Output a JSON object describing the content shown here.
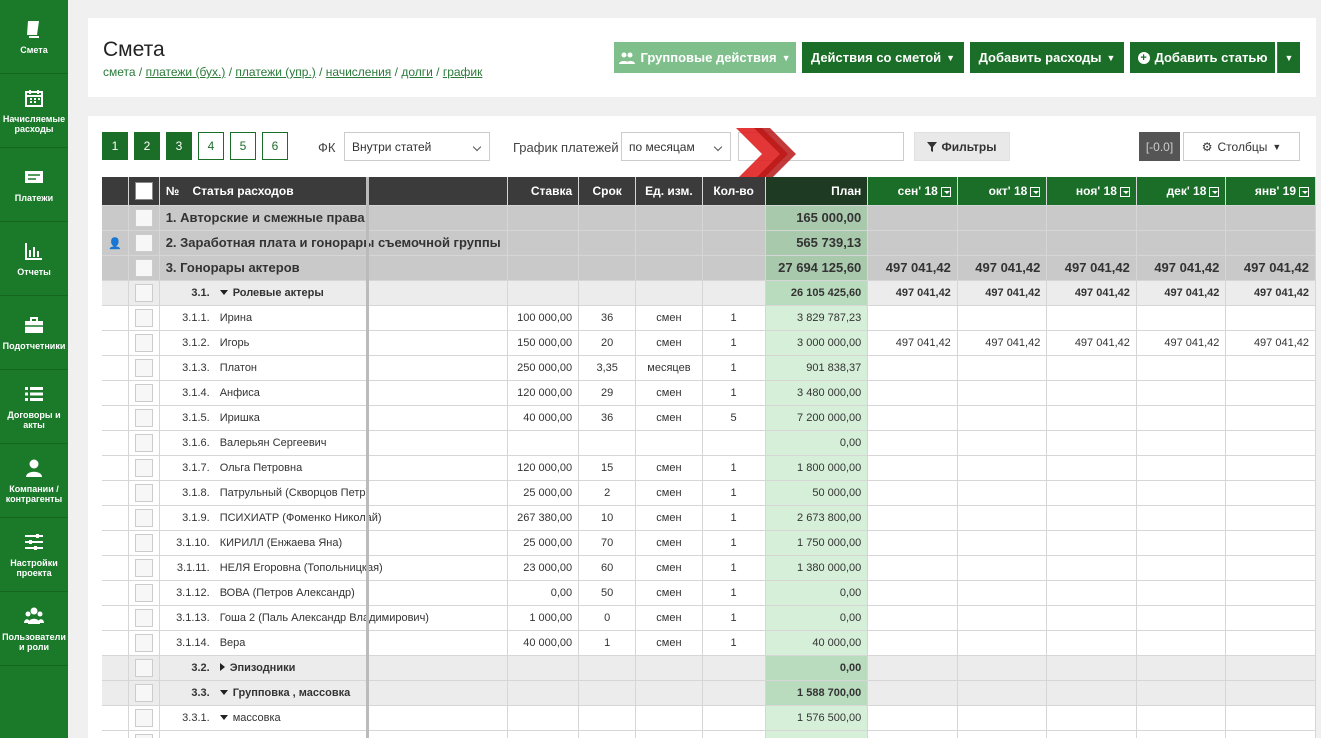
{
  "sidebar": {
    "items": [
      {
        "label": "Смета",
        "icon": "book-icon"
      },
      {
        "label": "Начисляемые расходы",
        "icon": "calendar-icon"
      },
      {
        "label": "Платежи",
        "icon": "payments-icon"
      },
      {
        "label": "Отчеты",
        "icon": "bar-chart-icon"
      },
      {
        "label": "Подотчетники",
        "icon": "briefcase-icon"
      },
      {
        "label": "Договоры и акты",
        "icon": "list-icon"
      },
      {
        "label": "Компании / контрагенты",
        "icon": "user-icon"
      },
      {
        "label": "Настройки проекта",
        "icon": "sliders-icon"
      },
      {
        "label": "Пользователи и роли",
        "icon": "users-icon"
      }
    ]
  },
  "header": {
    "title": "Смета",
    "breadcrumb": {
      "current": "смета",
      "links": [
        "платежи (бух.)",
        "платежи (упр.)",
        "начисления",
        "долги",
        "график"
      ]
    },
    "buttons": {
      "group": "Групповые действия",
      "estimate": "Действия со сметой",
      "add_expenses": "Добавить расходы",
      "add_article": "Добавить статью"
    }
  },
  "toolbar": {
    "pages": [
      "1",
      "2",
      "3",
      "4",
      "5",
      "6"
    ],
    "active_pages": [
      "1",
      "2",
      "3"
    ],
    "fk_label": "ФК",
    "fk_value": "Внутри статей",
    "schedule_label": "График платежей",
    "schedule_value": "по месяцам",
    "filters": "Фильтры",
    "version": "[-0.0]",
    "columns": "Столбцы"
  },
  "table": {
    "headers": {
      "num": "№",
      "article": "Статья расходов",
      "rate": "Ставка",
      "term": "Срок",
      "unit": "Ед. изм.",
      "qty": "Кол-во",
      "plan": "План"
    },
    "months": [
      "сен' 18",
      "окт' 18",
      "ноя' 18",
      "дек' 18",
      "янв' 19"
    ],
    "rows": [
      {
        "type": "grp",
        "num": "",
        "name": "1. Авторские и смежные права",
        "rate": "",
        "term": "",
        "unit": "",
        "qty": "",
        "plan": "165 000,00",
        "m": [
          "",
          "",
          "",
          "",
          ""
        ]
      },
      {
        "type": "grp",
        "num": "",
        "name": "2. Заработная плата и гонорары съемочной группы",
        "rate": "",
        "term": "",
        "unit": "",
        "qty": "",
        "plan": "565 739,13",
        "m": [
          "",
          "",
          "",
          "",
          ""
        ],
        "person": true
      },
      {
        "type": "grp",
        "num": "",
        "name": "3. Гонорары актеров",
        "rate": "",
        "term": "",
        "unit": "",
        "qty": "",
        "plan": "27 694 125,60",
        "m": [
          "497 041,42",
          "497 041,42",
          "497 041,42",
          "497 041,42",
          "497 041,42"
        ]
      },
      {
        "type": "sub",
        "num": "3.1.",
        "name": "Ролевые актеры",
        "exp": "d",
        "rate": "",
        "term": "",
        "unit": "",
        "qty": "",
        "plan": "26 105 425,60",
        "m": [
          "497 041,42",
          "497 041,42",
          "497 041,42",
          "497 041,42",
          "497 041,42"
        ]
      },
      {
        "type": "item",
        "num": "3.1.1.",
        "name": "Ирина",
        "rate": "100 000,00",
        "term": "36",
        "unit": "смен",
        "qty": "1",
        "plan": "3 829 787,23",
        "m": [
          "",
          "",
          "",
          "",
          ""
        ]
      },
      {
        "type": "item",
        "num": "3.1.2.",
        "name": "Игорь",
        "rate": "150 000,00",
        "term": "20",
        "unit": "смен",
        "qty": "1",
        "plan": "3 000 000,00",
        "m": [
          "497 041,42",
          "497 041,42",
          "497 041,42",
          "497 041,42",
          "497 041,42"
        ]
      },
      {
        "type": "item",
        "num": "3.1.3.",
        "name": "Платон",
        "rate": "250 000,00",
        "term": "3,35",
        "unit": "месяцев",
        "qty": "1",
        "plan": "901 838,37",
        "m": [
          "",
          "",
          "",
          "",
          ""
        ]
      },
      {
        "type": "item",
        "num": "3.1.4.",
        "name": "Анфиса",
        "rate": "120 000,00",
        "term": "29",
        "unit": "смен",
        "qty": "1",
        "plan": "3 480 000,00",
        "m": [
          "",
          "",
          "",
          "",
          ""
        ]
      },
      {
        "type": "item",
        "num": "3.1.5.",
        "name": "Иришка",
        "rate": "40 000,00",
        "term": "36",
        "unit": "смен",
        "qty": "5",
        "plan": "7 200 000,00",
        "m": [
          "",
          "",
          "",
          "",
          ""
        ]
      },
      {
        "type": "item",
        "num": "3.1.6.",
        "name": "Валерьян Сергеевич",
        "rate": "",
        "term": "",
        "unit": "",
        "qty": "",
        "plan": "0,00",
        "m": [
          "",
          "",
          "",
          "",
          ""
        ]
      },
      {
        "type": "item",
        "num": "3.1.7.",
        "name": "Ольга Петровна",
        "rate": "120 000,00",
        "term": "15",
        "unit": "смен",
        "qty": "1",
        "plan": "1 800 000,00",
        "m": [
          "",
          "",
          "",
          "",
          ""
        ]
      },
      {
        "type": "item",
        "num": "3.1.8.",
        "name": "Патрульный (Скворцов Петр)",
        "rate": "25 000,00",
        "term": "2",
        "unit": "смен",
        "qty": "1",
        "plan": "50 000,00",
        "m": [
          "",
          "",
          "",
          "",
          ""
        ]
      },
      {
        "type": "item",
        "num": "3.1.9.",
        "name": "ПСИХИАТР (Фоменко Николай)",
        "rate": "267 380,00",
        "term": "10",
        "unit": "смен",
        "qty": "1",
        "plan": "2 673 800,00",
        "m": [
          "",
          "",
          "",
          "",
          ""
        ]
      },
      {
        "type": "item",
        "num": "3.1.10.",
        "name": "КИРИЛЛ (Енжаева Яна)",
        "rate": "25 000,00",
        "term": "70",
        "unit": "смен",
        "qty": "1",
        "plan": "1 750 000,00",
        "m": [
          "",
          "",
          "",
          "",
          ""
        ]
      },
      {
        "type": "item",
        "num": "3.1.11.",
        "name": "НЕЛЯ Егоровна (Топольницкая)",
        "rate": "23 000,00",
        "term": "60",
        "unit": "смен",
        "qty": "1",
        "plan": "1 380 000,00",
        "m": [
          "",
          "",
          "",
          "",
          ""
        ]
      },
      {
        "type": "item",
        "num": "3.1.12.",
        "name": "ВОВА (Петров Александр)",
        "rate": "0,00",
        "term": "50",
        "unit": "смен",
        "qty": "1",
        "plan": "0,00",
        "m": [
          "",
          "",
          "",
          "",
          ""
        ]
      },
      {
        "type": "item",
        "num": "3.1.13.",
        "name": "Гоша 2 (Паль Александр Владимирович)",
        "rate": "1 000,00",
        "term": "0",
        "unit": "смен",
        "qty": "1",
        "plan": "0,00",
        "m": [
          "",
          "",
          "",
          "",
          ""
        ]
      },
      {
        "type": "item",
        "num": "3.1.14.",
        "name": "Вера",
        "rate": "40 000,00",
        "term": "1",
        "unit": "смен",
        "qty": "1",
        "plan": "40 000,00",
        "m": [
          "",
          "",
          "",
          "",
          ""
        ]
      },
      {
        "type": "sub",
        "num": "3.2.",
        "name": "Эпизодники",
        "exp": "r",
        "rate": "",
        "term": "",
        "unit": "",
        "qty": "",
        "plan": "0,00",
        "m": [
          "",
          "",
          "",
          "",
          ""
        ]
      },
      {
        "type": "sub",
        "num": "3.3.",
        "name": "Групповка , массовка",
        "exp": "d",
        "rate": "",
        "term": "",
        "unit": "",
        "qty": "",
        "plan": "1 588 700,00",
        "m": [
          "",
          "",
          "",
          "",
          ""
        ]
      },
      {
        "type": "item",
        "num": "3.3.1.",
        "name": "массовка",
        "exp": "d",
        "rate": "",
        "term": "",
        "unit": "",
        "qty": "",
        "plan": "1 576 500,00",
        "m": [
          "",
          "",
          "",
          "",
          ""
        ]
      },
      {
        "type": "item",
        "num": "",
        "name": "",
        "rate": "",
        "term": "",
        "unit": "",
        "qty": "",
        "plan": "",
        "m": [
          "",
          "",
          "",
          "",
          ""
        ]
      }
    ]
  },
  "colors": {
    "sidebar": "#1a7a2a",
    "button": "#1b6e28",
    "button_light": "#7fbf8c",
    "plan_bg": "#d6efd9",
    "annotation_arrow": "#e02020"
  }
}
